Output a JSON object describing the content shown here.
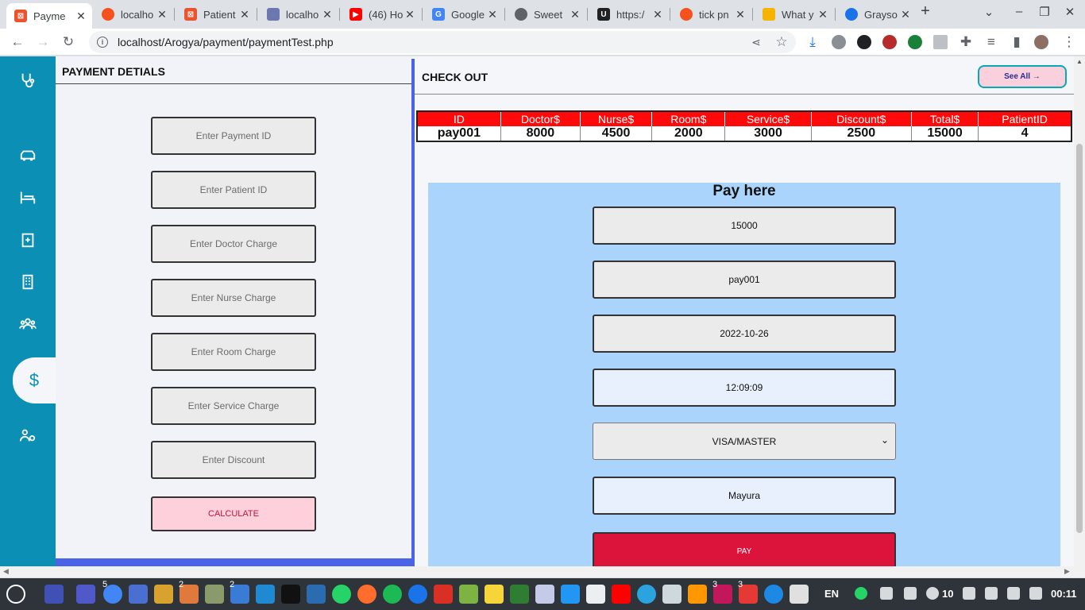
{
  "browser": {
    "tabs": [
      {
        "title": "Payme",
        "favicon_color": "#e9532d",
        "active": true
      },
      {
        "title": "localho",
        "favicon_color": "#f4511e"
      },
      {
        "title": "Patient",
        "favicon_color": "#e9532d"
      },
      {
        "title": "localho",
        "favicon_color": "#6c78af"
      },
      {
        "title": "(46) Ho",
        "favicon_color": "#ff0000"
      },
      {
        "title": "Google",
        "favicon_color": "#4285f4"
      },
      {
        "title": "Sweet",
        "favicon_color": "#5f6368"
      },
      {
        "title": "https:/",
        "favicon_color": "#202124"
      },
      {
        "title": "tick pn",
        "favicon_color": "#f4511e"
      },
      {
        "title": "What y",
        "favicon_color": "#f5b400"
      },
      {
        "title": "Grayso",
        "favicon_color": "#1a73e8"
      }
    ],
    "new_tab_icon": "plus-icon",
    "address": "localhost/Arogya/payment/paymentTest.php"
  },
  "sidebar": {
    "items": [
      {
        "icon": "stethoscope-icon"
      },
      {
        "icon": "ambulance-icon"
      },
      {
        "icon": "hospital-bed-icon"
      },
      {
        "icon": "clipboard-medical-icon"
      },
      {
        "icon": "hospital-building-icon"
      },
      {
        "icon": "group-icon"
      },
      {
        "icon": "dollar-icon",
        "label": "$",
        "active": true
      },
      {
        "icon": "users-gear-icon"
      }
    ]
  },
  "payment_details": {
    "title": "PAYMENT DETIALS",
    "fields": [
      {
        "placeholder": "Enter Payment ID"
      },
      {
        "placeholder": "Enter Patient ID"
      },
      {
        "placeholder": "Enter Doctor Charge"
      },
      {
        "placeholder": "Enter Nurse Charge"
      },
      {
        "placeholder": "Enter Room Charge"
      },
      {
        "placeholder": "Enter Service Charge"
      },
      {
        "placeholder": "Enter Discount"
      }
    ],
    "calculate_label": "CALCULATE"
  },
  "checkout": {
    "title": "CHECK OUT",
    "see_all_label": "See All →",
    "table": {
      "headers": [
        "ID",
        "Doctor$",
        "Nurse$",
        "Room$",
        "Service$",
        "Discount$",
        "Total$",
        "PatientID"
      ],
      "rows": [
        [
          "pay001",
          "8000",
          "4500",
          "2000",
          "3000",
          "2500",
          "15000",
          "4"
        ]
      ]
    }
  },
  "pay_here": {
    "title": "Pay here",
    "amount": "15000",
    "payment_id": "pay001",
    "date": "2022-10-26",
    "time": "12:09:09",
    "card_type": "VISA/MASTER",
    "name": "Mayura",
    "pay_label": "PAY"
  },
  "taskbar": {
    "badges": {
      "chrome": "5",
      "app_a": "2",
      "app_b": "2",
      "app_c": "3",
      "app_d": "3"
    },
    "language": "EN",
    "volume": "10",
    "clock": "00:11"
  },
  "colors": {
    "sidebar": "#0c8fb5",
    "table_header": "#ff0a0a",
    "pay_button": "#dc143c",
    "pay_box": "#aad4fc",
    "divider": "#4b63e6"
  }
}
